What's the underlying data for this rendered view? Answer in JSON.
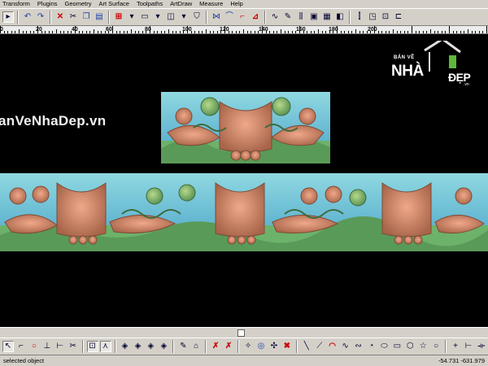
{
  "menu": [
    "Transform",
    "Plugins",
    "Geometry",
    "Art Surface",
    "Toolpaths",
    "ArtDraw",
    "Measure",
    "Help"
  ],
  "ruler": {
    "labels": [
      "0",
      "20",
      "40",
      "60",
      "80",
      "100",
      "120",
      "140",
      "160",
      "180",
      "200"
    ]
  },
  "canvas": {
    "watermark": "anVeNhaDep.vn",
    "background": "#000000"
  },
  "logo": {
    "top": "BẢN VẼ",
    "nha": "NHÀ",
    "dep": "ĐẸP",
    "vn": ".vn"
  },
  "status": {
    "message": "selected object",
    "coords": "-54.731 -631.979"
  }
}
